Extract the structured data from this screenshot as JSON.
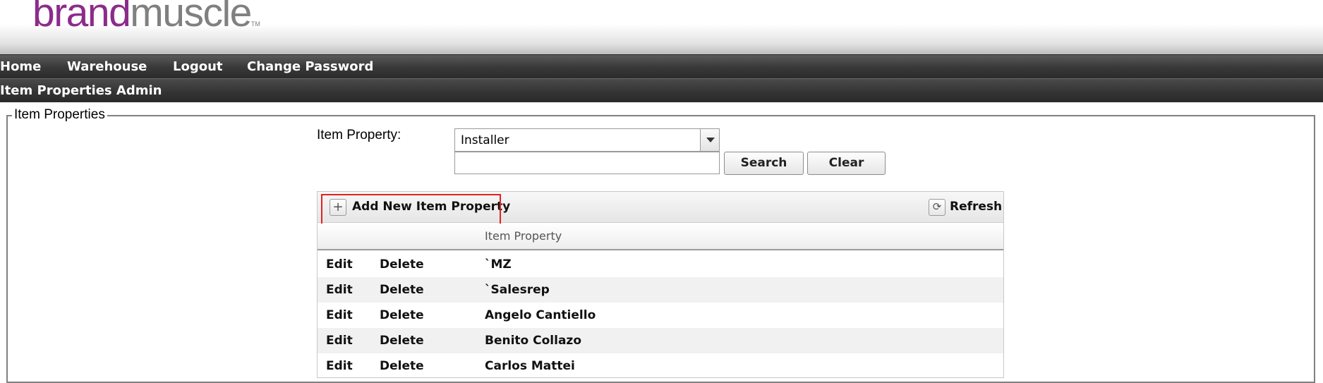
{
  "logo": {
    "brand": "brand",
    "muscle": "muscle",
    "tm": "TM"
  },
  "nav": {
    "items": [
      "Home",
      "Warehouse",
      "Logout",
      "Change Password"
    ]
  },
  "subnav": {
    "title": "Item Properties Admin"
  },
  "section": {
    "legend": "Item Properties"
  },
  "filter": {
    "label": "Item Property:",
    "selected": "Installer",
    "search_value": "",
    "search_button": "Search",
    "clear_button": "Clear"
  },
  "grid": {
    "add_label": "Add New Item Property",
    "refresh_label": "Refresh",
    "column_header": "Item Property",
    "edit_label": "Edit",
    "delete_label": "Delete",
    "rows": [
      "`MZ",
      "`Salesrep",
      "Angelo Cantiello",
      "Benito Collazo",
      "Carlos Mattei"
    ]
  },
  "colors": {
    "brand": "#8b2c8a",
    "logo_gray": "#808080",
    "nav_bg": "#3a3a3a",
    "highlight": "#e02222"
  }
}
